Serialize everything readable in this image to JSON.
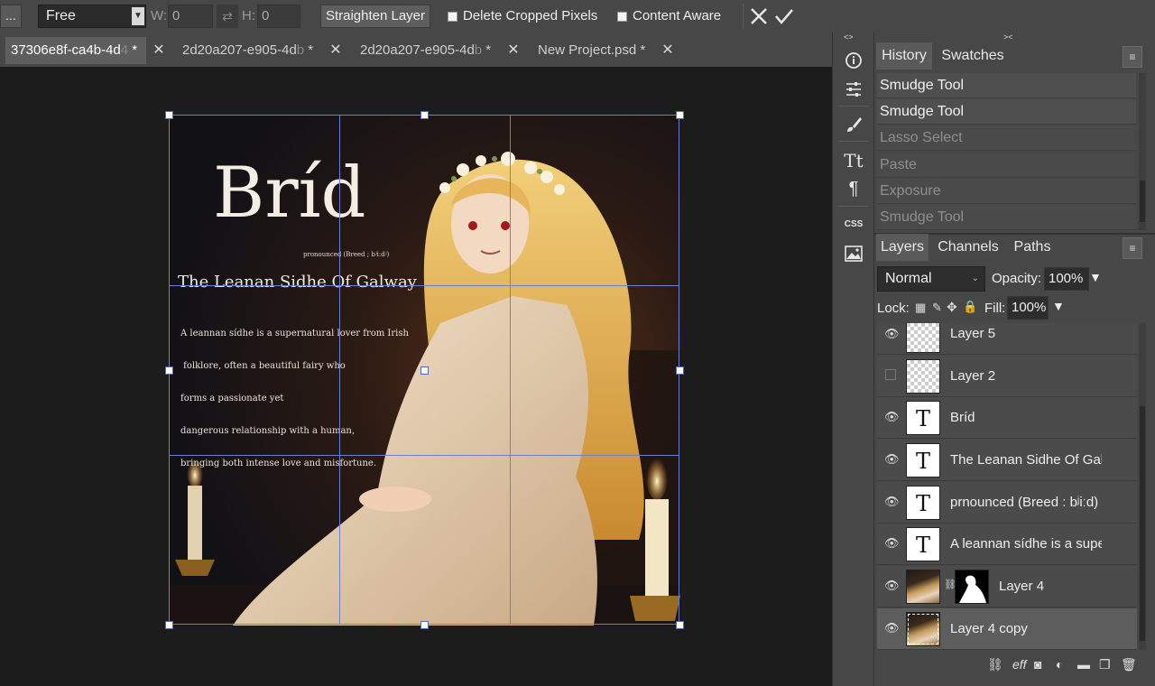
{
  "options_bar": {
    "more_label": "...",
    "ratio_mode": "Free",
    "width_label": "W:",
    "width_value": "0",
    "height_label": "H:",
    "height_value": "0",
    "straighten_label": "Straighten Layer",
    "delete_cropped_label": "Delete Cropped Pixels",
    "content_aware_label": "Content Aware"
  },
  "tabs": [
    {
      "label": "37306e8f-ca4b-4d",
      "fade": "4",
      "suffix": " *"
    },
    {
      "label": "2d20a207-e905-4d",
      "fade": "b",
      "suffix": " *"
    },
    {
      "label": "2d20a207-e905-4d",
      "fade": "b",
      "suffix": " *"
    },
    {
      "label": "New Project.psd",
      "fade": "",
      "suffix": " *"
    }
  ],
  "artwork": {
    "title": "Bríd",
    "pronunciation": "pronounced (Breed ; bʲiːdʲ)",
    "subtitle": "The Leanan Sidhe Of Galway",
    "body_lines": [
      "A leannan sídhe is a supernatural lover from Irish",
      " folklore, often a beautiful fairy who",
      "forms a passionate yet",
      "dangerous relationship with a human,",
      "bringing both intense love and misfortune."
    ]
  },
  "tools": [
    "info-icon",
    "adjustments-icon",
    "brush-icon",
    "character-icon",
    "paragraph-icon",
    "css-icon",
    "image-icon"
  ],
  "tools_css_label": "CSS",
  "history_panel": {
    "tabs": [
      "History",
      "Swatches"
    ],
    "items": [
      {
        "label": "Smudge Tool",
        "state": "done"
      },
      {
        "label": "Smudge Tool",
        "state": "done"
      },
      {
        "label": "Lasso Select",
        "state": "undone"
      },
      {
        "label": "Paste",
        "state": "undone"
      },
      {
        "label": "Exposure",
        "state": "undone"
      },
      {
        "label": "Smudge Tool",
        "state": "undone"
      }
    ]
  },
  "layers_panel": {
    "tabs": [
      "Layers",
      "Channels",
      "Paths"
    ],
    "blend_mode": "Normal",
    "opacity_label": "Opacity:",
    "opacity_value": "100%",
    "lock_label": "Lock:",
    "fill_label": "Fill:",
    "fill_value": "100%",
    "layers": [
      {
        "name": "Layer 5",
        "type": "raster",
        "visible": true
      },
      {
        "name": "Layer 2",
        "type": "raster",
        "visible": false
      },
      {
        "name": "Bríd",
        "type": "text",
        "visible": true
      },
      {
        "name": "The Leanan Sidhe Of Galway",
        "type": "text",
        "visible": true
      },
      {
        "name": "prnounced (Breed : bʲiːd)",
        "type": "text",
        "visible": true
      },
      {
        "name": "A leannan sídhe is a supernatural lover",
        "type": "text",
        "visible": true
      },
      {
        "name": "Layer 4",
        "type": "image-masked",
        "visible": true
      },
      {
        "name": "Layer 4 copy",
        "type": "image",
        "visible": true,
        "selected": true
      }
    ],
    "bottom_icons": [
      "link-icon",
      "effects-icon",
      "mask-icon",
      "adjustment-icon",
      "folder-icon",
      "new-layer-icon",
      "trash-icon"
    ]
  }
}
